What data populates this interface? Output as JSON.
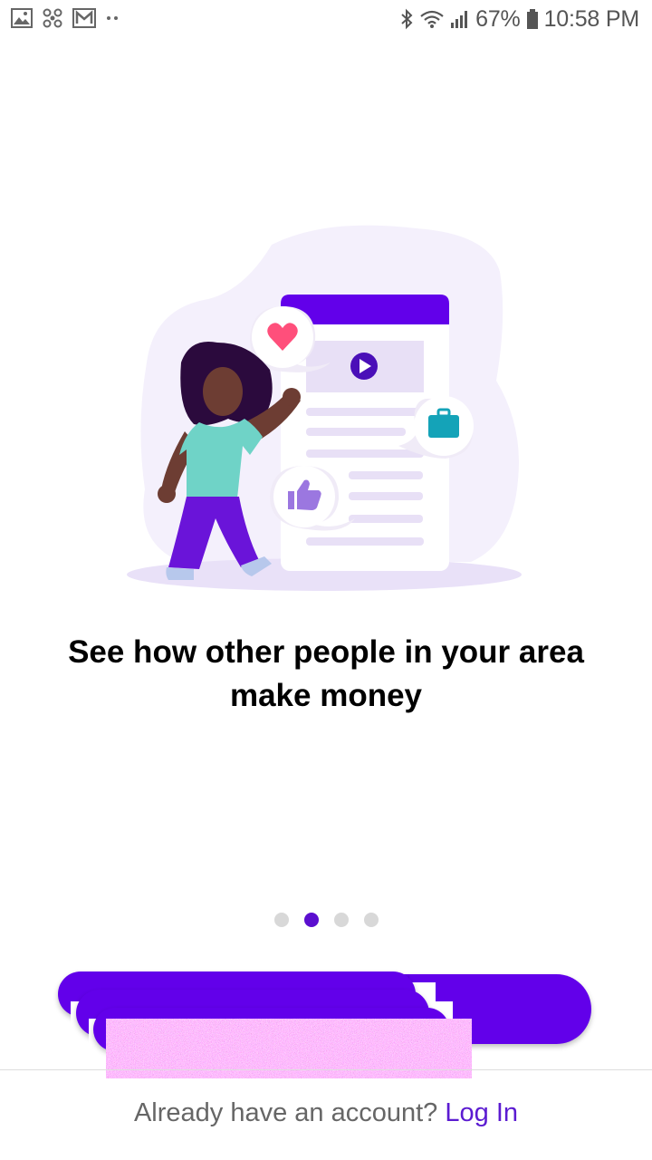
{
  "status_bar": {
    "left_icons": [
      "image-icon",
      "fan-icon",
      "gmail-icon",
      "more-dots-icon"
    ],
    "right_icons": [
      "bluetooth-icon",
      "wifi-icon",
      "signal-icon",
      "battery-icon"
    ],
    "battery": "67%",
    "time": "10:58 PM"
  },
  "illustration": {
    "elements": [
      "person-illustration",
      "phone-feed-illustration",
      "heart-icon",
      "play-icon",
      "briefcase-icon",
      "thumbs-up-icon"
    ]
  },
  "onboarding": {
    "headline_line1": "See how other people in your area",
    "headline_line2": "make money",
    "page_count": 4,
    "current_page": 2
  },
  "footer": {
    "prompt": "Already have an account?",
    "login_label": "Log In"
  },
  "colors": {
    "primary": "#6200ea",
    "dot_active": "#5b0ecf",
    "dot_inactive": "#d8d8d8",
    "login_link": "#5b1bd1",
    "teal": "#6fd3c7",
    "heart": "#ff4f7b"
  }
}
